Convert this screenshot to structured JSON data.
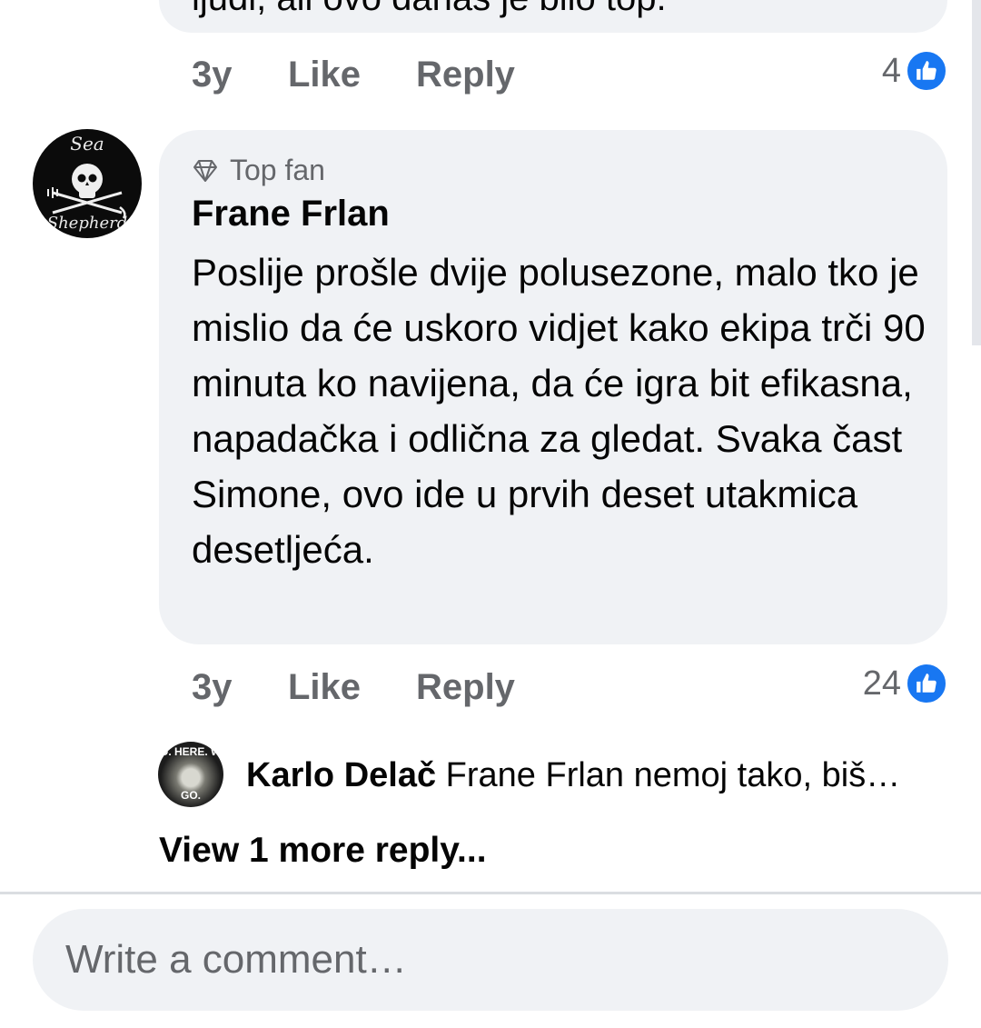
{
  "previous_comment": {
    "cut_text": "ljudi, ali ovo danas je bilo top.",
    "time": "3y",
    "like_label": "Like",
    "reply_label": "Reply",
    "reaction_count": "4"
  },
  "comment": {
    "avatar_text_top": "Sea",
    "avatar_text_bottom": "Shepherd",
    "badge": "Top fan",
    "author": "Frane Frlan",
    "text": "Poslije prošle dvije polusezone, malo tko je mislio da će uskoro vidjet kako ekipa trči 90 minuta ko navijena, da će igra bit efikasna, napadačka i odlična za gledat. Svaka čast Simone, ovo ide u prvih deset utakmica desetljeća.",
    "time": "3y",
    "like_label": "Like",
    "reply_label": "Reply",
    "reaction_count": "24"
  },
  "reply_preview": {
    "avatar_text_top": "D. HERE. W",
    "avatar_text_bottom": "GO.",
    "author": "Karlo Delač",
    "text": "Frane Frlan nemoj tako, biš…"
  },
  "view_more_label": "View 1 more reply...",
  "composer": {
    "placeholder": "Write a comment…"
  },
  "colors": {
    "bubble": "#f0f2f5",
    "secondary_text": "#65676b",
    "like_blue": "#1877f2"
  }
}
